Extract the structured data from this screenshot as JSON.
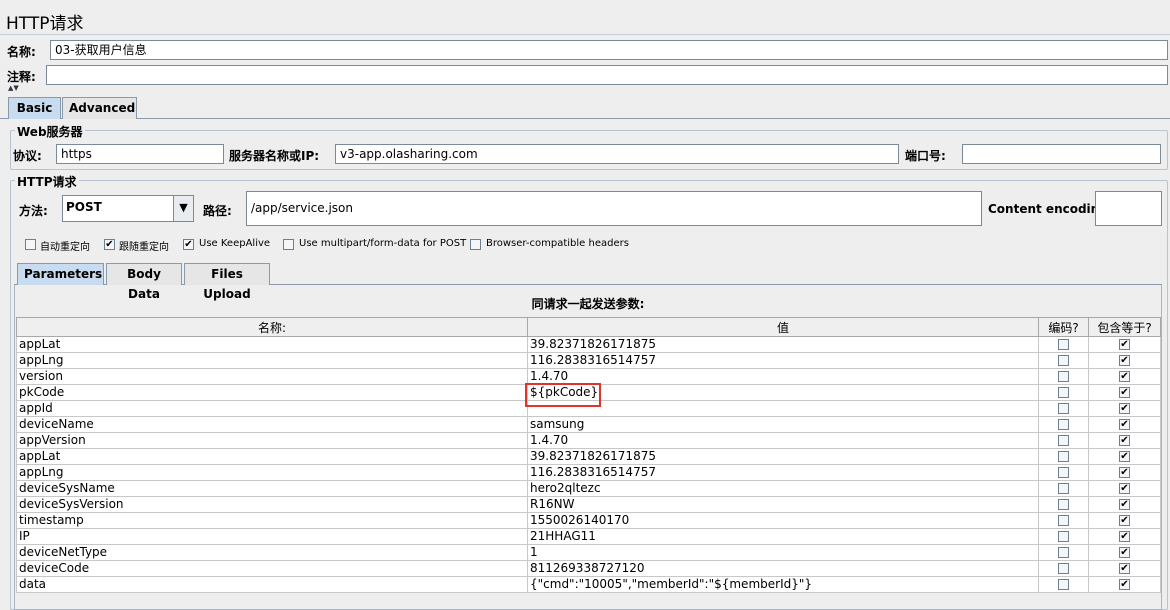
{
  "title": "HTTP请求",
  "name_label": "名称:",
  "name_value": "03-获取用户信息",
  "comment_label": "注释:",
  "comment_value": "",
  "tabs": [
    "Basic",
    "Advanced"
  ],
  "web_server": {
    "group_title": "Web服务器",
    "protocol_label": "协议:",
    "protocol_value": "https",
    "server_label": "服务器名称或IP:",
    "server_value": "v3-app.olasharing.com",
    "port_label": "端口号:",
    "port_value": ""
  },
  "http_request": {
    "group_title": "HTTP请求",
    "method_label": "方法:",
    "method_value": "POST",
    "path_label": "路径:",
    "path_value": "/app/service.json",
    "encoding_label": "Content encoding:",
    "encoding_value": ""
  },
  "options": [
    {
      "label": "自动重定向",
      "checked": false
    },
    {
      "label": "跟随重定向",
      "checked": true
    },
    {
      "label": "Use KeepAlive",
      "checked": true
    },
    {
      "label": "Use multipart/form-data for POST",
      "checked": false
    },
    {
      "label": "Browser-compatible headers",
      "checked": false
    }
  ],
  "subtabs": [
    "Parameters",
    "Body Data",
    "Files Upload"
  ],
  "params_caption": "同请求一起发送参数:",
  "columns": [
    "名称:",
    "值",
    "编码?",
    "包含等于?"
  ],
  "check_mark": "✔",
  "rows": [
    {
      "name": "appLat",
      "value": "39.82371826171875",
      "encode": false,
      "include": true
    },
    {
      "name": "appLng",
      "value": "116.2838316514757",
      "encode": false,
      "include": true
    },
    {
      "name": "version",
      "value": "1.4.70",
      "encode": false,
      "include": true
    },
    {
      "name": "pkCode",
      "value": "${pkCode}",
      "encode": false,
      "include": true
    },
    {
      "name": "appId",
      "value": "",
      "encode": false,
      "include": true
    },
    {
      "name": "deviceName",
      "value": "samsung",
      "encode": false,
      "include": true
    },
    {
      "name": "appVersion",
      "value": "1.4.70",
      "encode": false,
      "include": true
    },
    {
      "name": "appLat",
      "value": "39.82371826171875",
      "encode": false,
      "include": true
    },
    {
      "name": "appLng",
      "value": "116.2838316514757",
      "encode": false,
      "include": true
    },
    {
      "name": "deviceSysName",
      "value": "hero2qltezc",
      "encode": false,
      "include": true
    },
    {
      "name": "deviceSysVersion",
      "value": "R16NW",
      "encode": false,
      "include": true
    },
    {
      "name": "timestamp",
      "value": "1550026140170",
      "encode": false,
      "include": true
    },
    {
      "name": "IP",
      "value": "21HHAG11",
      "encode": false,
      "include": true
    },
    {
      "name": "deviceNetType",
      "value": "1",
      "encode": false,
      "include": true
    },
    {
      "name": "deviceCode",
      "value": "811269338727120",
      "encode": false,
      "include": true
    },
    {
      "name": "data",
      "value": "{\"cmd\":\"10005\",\"memberId\":\"${memberId}\"}",
      "encode": false,
      "include": true
    }
  ]
}
